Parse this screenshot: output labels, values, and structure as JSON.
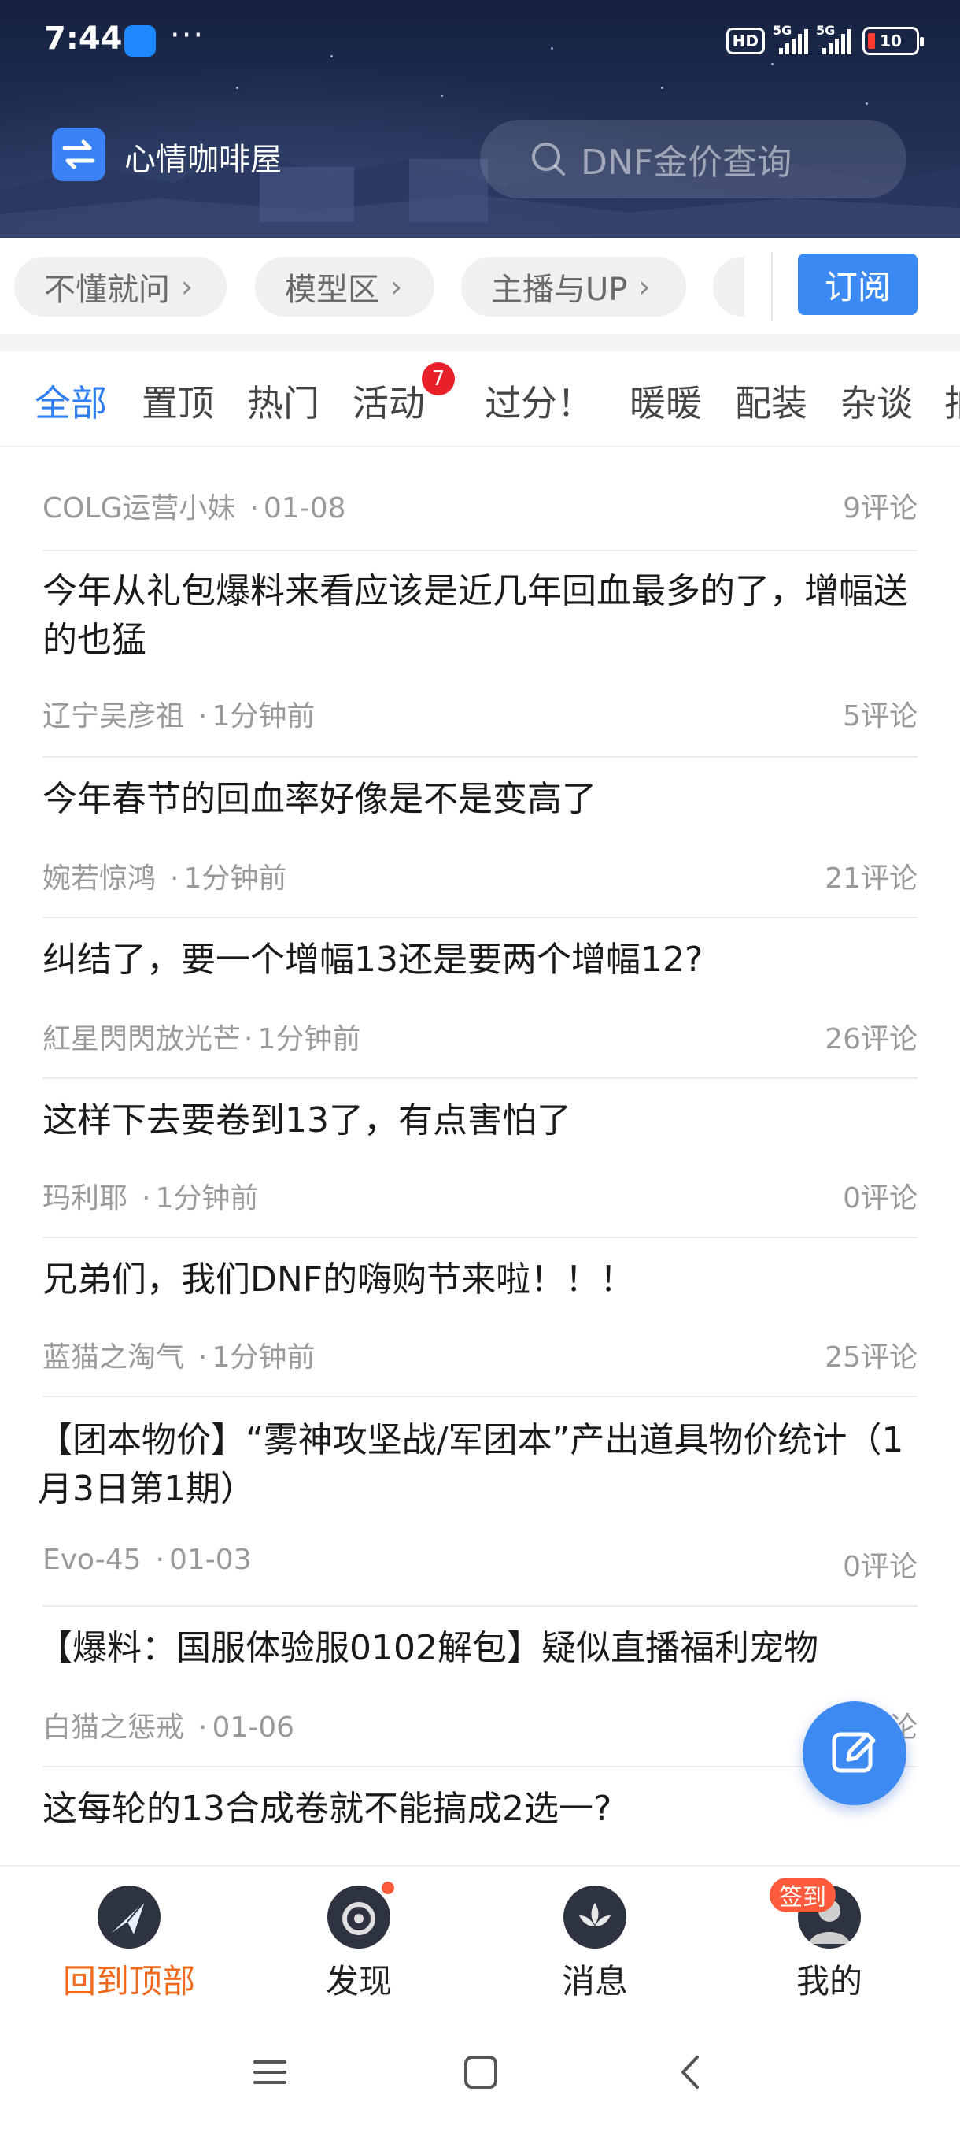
{
  "status_bar": {
    "time": "7:44",
    "more": "···",
    "hd_label": "HD",
    "network_1": "5G",
    "network_2": "5G",
    "battery": "10"
  },
  "header": {
    "board_name": "心情咖啡屋",
    "search_placeholder": "DNF金价查询"
  },
  "chips": [
    {
      "label": "不懂就问"
    },
    {
      "label": "模型区"
    },
    {
      "label": "主播与UP"
    }
  ],
  "subscribe_label": "订阅",
  "tabs": [
    {
      "label": "全部",
      "active": true
    },
    {
      "label": "置顶"
    },
    {
      "label": "热门"
    },
    {
      "label": "活动"
    },
    {
      "label": "过分！"
    },
    {
      "label": "暖暖"
    },
    {
      "label": "配装"
    },
    {
      "label": "杂谈"
    },
    {
      "label": "拍"
    }
  ],
  "tab_badge": "7",
  "posts": [
    {
      "author": "COLG运营小妹",
      "time": "01-08",
      "comments": "9评论"
    },
    {
      "title": "今年从礼包爆料来看应该是近几年回血最多的了，增幅送的也猛",
      "author": "辽宁吴彦祖",
      "time": "1分钟前",
      "comments": "5评论"
    },
    {
      "title": "今年春节的回血率好像是不是变高了",
      "author": "婉若惊鸿",
      "time": "1分钟前",
      "comments": "21评论"
    },
    {
      "title": "纠结了，要一个增幅13还是要两个增幅12?",
      "author": "紅星閃閃放光芒",
      "time": "1分钟前",
      "comments": "26评论"
    },
    {
      "title": "这样下去要卷到13了，有点害怕了",
      "author": "玛利耶",
      "time": "1分钟前",
      "comments": "0评论"
    },
    {
      "title": "兄弟们，我们DNF的嗨购节来啦！！！",
      "author": "蓝猫之淘气",
      "time": "1分钟前",
      "comments": "25评论"
    },
    {
      "title": "【团本物价】“雾神攻坚战/军团本”产出道具物价统计（1月3日第1期）",
      "author": "Evo-45",
      "time": "01-03",
      "comments": "0评论"
    },
    {
      "title": "【爆料：国服体验服0102解包】疑似直播福利宠物",
      "author": "白猫之惩戒",
      "time": "01-06",
      "comments": "论"
    },
    {
      "title": "这每轮的13合成卷就不能搞成2选一?"
    }
  ],
  "bottom_nav": [
    {
      "label": "回到顶部",
      "active": true,
      "icon": "back-to-top-icon"
    },
    {
      "label": "发现",
      "icon": "discover-icon"
    },
    {
      "label": "消息",
      "icon": "message-icon"
    },
    {
      "label": "我的",
      "icon": "profile-icon"
    }
  ],
  "checkin_label": "签到",
  "colors": {
    "accent": "#2f7ff0",
    "active_nav": "#ef6a1d",
    "badge_red": "#e8202a"
  }
}
